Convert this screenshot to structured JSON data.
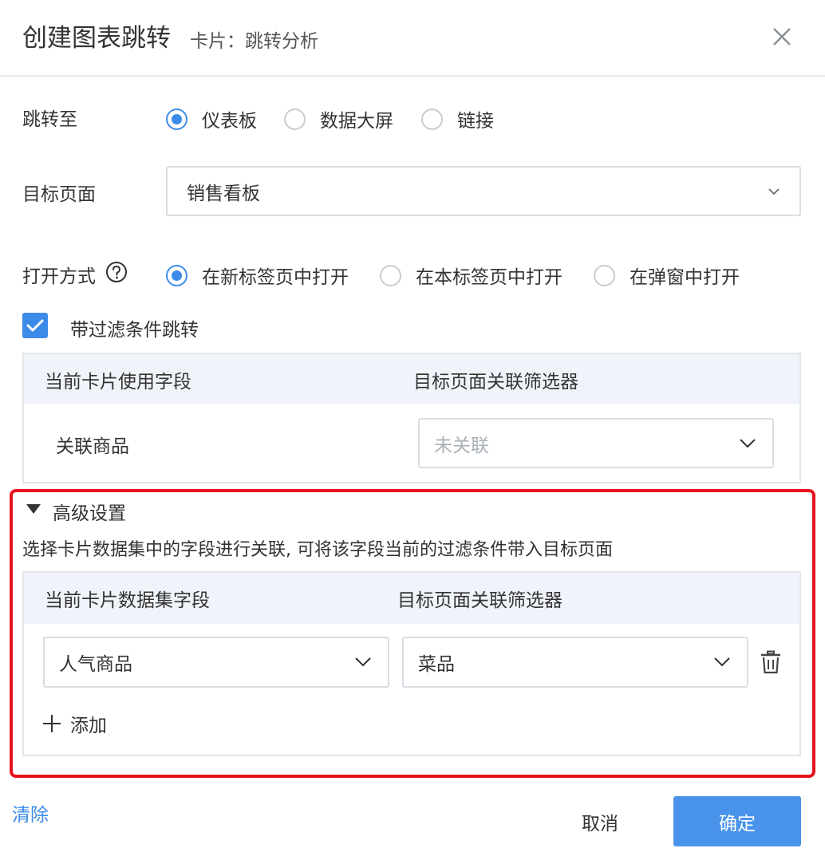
{
  "dialog": {
    "title": "创建图表跳转",
    "subtitle": "卡片：跳转分析",
    "close_icon": "close-icon"
  },
  "jump_to": {
    "label": "跳转至",
    "options": [
      "仪表板",
      "数据大屏",
      "链接"
    ],
    "selected": "仪表板"
  },
  "target_page": {
    "label": "目标页面",
    "value": "销售看板"
  },
  "open_mode": {
    "label": "打开方式",
    "help_icon": "question-circle-icon",
    "options": [
      "在新标签页中打开",
      "在本标签页中打开",
      "在弹窗中打开"
    ],
    "selected": "在新标签页中打开"
  },
  "filter_jump": {
    "checked": true,
    "label": "带过滤条件跳转",
    "table": {
      "col1": "当前卡片使用字段",
      "col2": "目标页面关联筛选器",
      "rows": [
        {
          "field": "关联商品",
          "filter_placeholder": "未关联"
        }
      ]
    }
  },
  "advanced": {
    "title": "高级设置",
    "expanded": true,
    "description": "选择卡片数据集中的字段进行关联, 可将该字段当前的过滤条件带入目标页面",
    "table": {
      "col1": "当前卡片数据集字段",
      "col2": "目标页面关联筛选器",
      "rows": [
        {
          "field": "人气商品",
          "filter": "菜品"
        }
      ]
    },
    "add_label": "添加",
    "highlight_color": "#e5131d"
  },
  "footer": {
    "clear": "清除",
    "cancel": "取消",
    "confirm": "确定"
  },
  "colors": {
    "accent": "#3d8be8",
    "primary_button": "#4a93ea"
  }
}
